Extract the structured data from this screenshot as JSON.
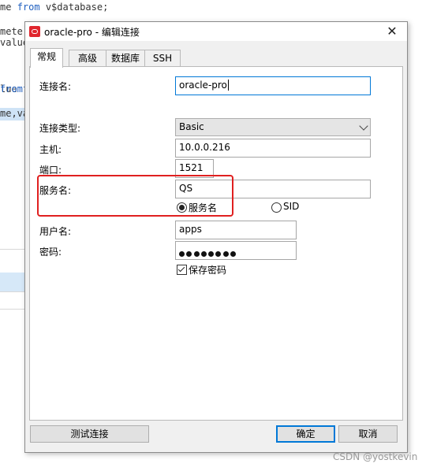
{
  "background_editor": {
    "lines": [
      {
        "pre": "me ",
        "kw": "from",
        "post": " v$database;"
      },
      {
        "pre": "",
        "kw": "",
        "post": ""
      },
      {
        "pre": "meter",
        "kw": "",
        "post": ""
      },
      {
        "pre": "value",
        "kw": "",
        "post": ""
      },
      {
        "pre": "",
        "kw": "",
        "post": ""
      },
      {
        "pre": "lue ",
        "kw": "f",
        "post": ""
      },
      {
        "pre": "",
        "kw": "",
        "post": ""
      },
      {
        "pre": "",
        "kw": "from",
        "post": ""
      },
      {
        "pre": "",
        "kw": "",
        "post": ""
      },
      {
        "pre": "me,va",
        "kw": "",
        "post": ""
      }
    ]
  },
  "dialog": {
    "title": "oracle-pro - 编辑连接",
    "close_glyph": "✕",
    "tabs": [
      "常规",
      "高级",
      "数据库",
      "SSH"
    ],
    "active_tab": "常规",
    "form": {
      "connection_name_label": "连接名:",
      "connection_name_value": "oracle-pro",
      "connection_type_label": "连接类型:",
      "connection_type_value": "Basic",
      "host_label": "主机:",
      "host_value": "10.0.0.216",
      "port_label": "端口:",
      "port_value": "1521",
      "service_name_label": "服务名:",
      "service_name_value": "QS",
      "radio_service_name": "服务名",
      "radio_sid": "SID",
      "selected_radio": "服务名",
      "username_label": "用户名:",
      "username_value": "apps",
      "password_label": "密码:",
      "password_mask_count": 8,
      "save_password_label": "保存密码",
      "save_password_checked": true
    },
    "buttons": {
      "test": "测试连接",
      "ok": "确定",
      "cancel": "取消"
    }
  },
  "annotation": {
    "color": "#e02020"
  },
  "watermark": "CSDN @yostkevin"
}
